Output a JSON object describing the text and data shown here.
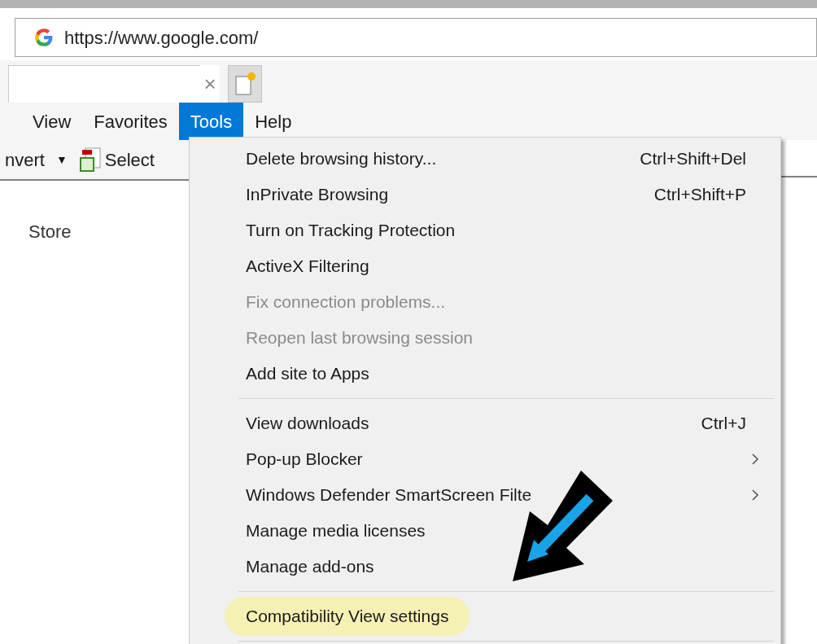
{
  "address_bar": {
    "url": "https://www.google.com/"
  },
  "tab": {
    "close": "×"
  },
  "menu_bar": [
    {
      "label": "View",
      "selected": false
    },
    {
      "label": "Favorites",
      "selected": false
    },
    {
      "label": "Tools",
      "selected": true
    },
    {
      "label": "Help",
      "selected": false
    }
  ],
  "toolbar": {
    "convert": "nvert",
    "dropdown": "▼",
    "select": "Select"
  },
  "page": {
    "link": "Store"
  },
  "tools_menu": {
    "groups": [
      [
        {
          "label": "Delete browsing history...",
          "shortcut": "Ctrl+Shift+Del",
          "submenu": false,
          "disabled": false,
          "highlighted": false
        },
        {
          "label": "InPrivate Browsing",
          "shortcut": "Ctrl+Shift+P",
          "submenu": false,
          "disabled": false,
          "highlighted": false
        },
        {
          "label": "Turn on Tracking Protection",
          "submenu": false,
          "disabled": false,
          "highlighted": false
        },
        {
          "label": "ActiveX Filtering",
          "submenu": false,
          "disabled": false,
          "highlighted": false
        },
        {
          "label": "Fix connection problems...",
          "submenu": false,
          "disabled": true,
          "highlighted": false
        },
        {
          "label": "Reopen last browsing session",
          "submenu": false,
          "disabled": true,
          "highlighted": false
        },
        {
          "label": "Add site to Apps",
          "submenu": false,
          "disabled": false,
          "highlighted": false
        }
      ],
      [
        {
          "label": "View downloads",
          "shortcut": "Ctrl+J",
          "submenu": false,
          "disabled": false,
          "highlighted": false
        },
        {
          "label": "Pop-up Blocker",
          "submenu": true,
          "disabled": false,
          "highlighted": false
        },
        {
          "label": "Windows Defender SmartScreen Filte",
          "submenu": true,
          "disabled": false,
          "highlighted": false
        },
        {
          "label": "Manage media licenses",
          "submenu": false,
          "disabled": false,
          "highlighted": false
        },
        {
          "label": "Manage add-ons",
          "submenu": false,
          "disabled": false,
          "highlighted": false
        }
      ],
      [
        {
          "label": "Compatibility View settings",
          "submenu": false,
          "disabled": false,
          "highlighted": true
        }
      ]
    ]
  }
}
